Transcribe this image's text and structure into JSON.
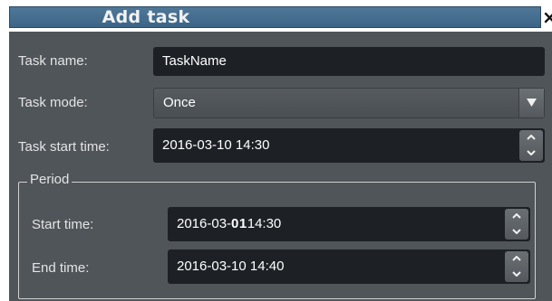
{
  "dialog": {
    "title": "Add task",
    "close_glyph": "×"
  },
  "form": {
    "task_name_label": "Task name:",
    "task_name_value": "TaskName",
    "task_mode_label": "Task mode:",
    "task_mode_value": "Once",
    "task_start_label": "Task start time:",
    "task_start_value": "2016-03-10 14:30"
  },
  "period": {
    "legend": "Period",
    "start_label": "Start time:",
    "start_value_prefix": "2016-03-",
    "start_value_highlight": "01",
    "start_value_suffix": "14:30",
    "end_label": "End time:",
    "end_value": "2016-03-10 14:40"
  },
  "icons": {
    "dropdown": "triangle-down-icon",
    "spin_up": "chevron-up-icon",
    "spin_down": "chevron-down-icon",
    "close": "close-icon"
  },
  "colors": {
    "title_bar": "#3b6486",
    "panel_bg": "#50555a",
    "field_bg": "#1d2126"
  }
}
